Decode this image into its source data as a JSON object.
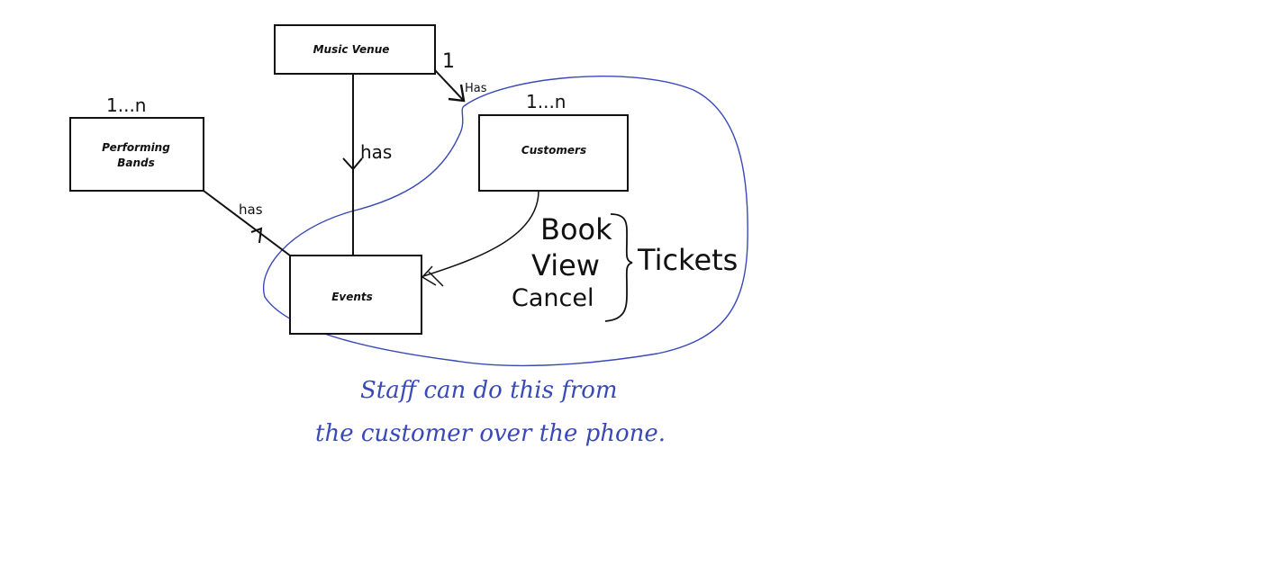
{
  "entities": {
    "music_venue": "Music Venue",
    "performing_bands_line1": "Performing",
    "performing_bands_line2": "Bands",
    "customers": "Customers",
    "events": "Events"
  },
  "relations": {
    "venue_events": "has",
    "venue_customers": "Has",
    "bands_events": "has"
  },
  "multiplicities": {
    "venue": "1",
    "customers": "1...n",
    "bands": "1...n"
  },
  "ticket_actions": [
    "Book",
    "View",
    "Cancel"
  ],
  "ticket_group": "Tickets",
  "note_lines": [
    "Staff can do this from",
    "the customer over the phone."
  ],
  "colors": {
    "ink": "#111111",
    "annotation": "#3a49b8",
    "background": "#ffffff"
  }
}
